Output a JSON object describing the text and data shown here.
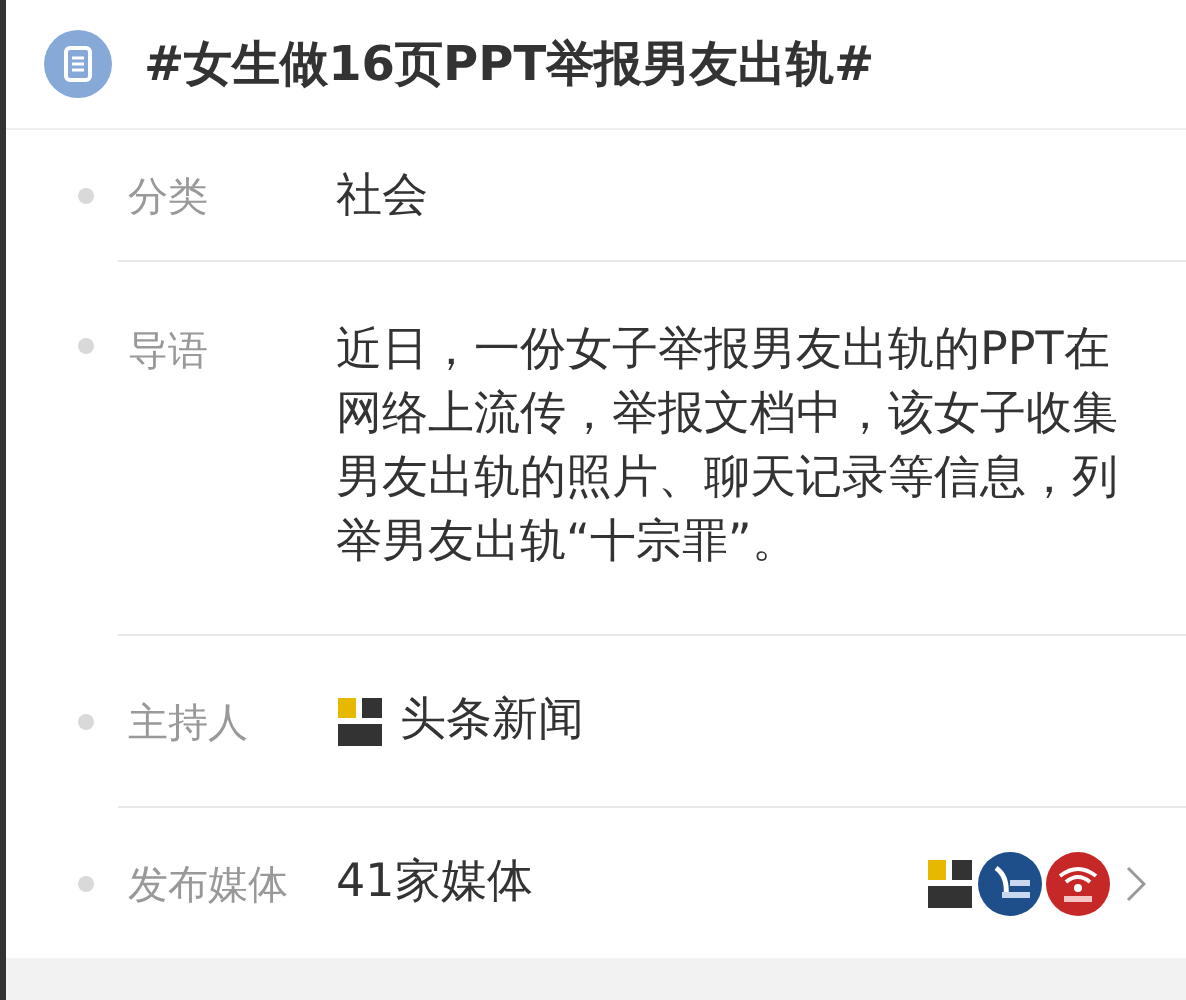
{
  "topic": {
    "title": "#女生做16页PPT举报男友出轨#"
  },
  "rows": [
    {
      "kind": "text",
      "label": "分类",
      "value": "社会"
    },
    {
      "kind": "text",
      "label": "导语",
      "value": "近日，一份女子举报男友出轨的PPT在网络上流传，举报文档中，该女子收集男友出轨的照片、聊天记录等信息，列举男友出轨“十宗罪”。"
    },
    {
      "kind": "host",
      "label": "主持人",
      "value": "头条新闻"
    },
    {
      "kind": "media",
      "label": "发布媒体",
      "value": "41家媒体"
    }
  ]
}
